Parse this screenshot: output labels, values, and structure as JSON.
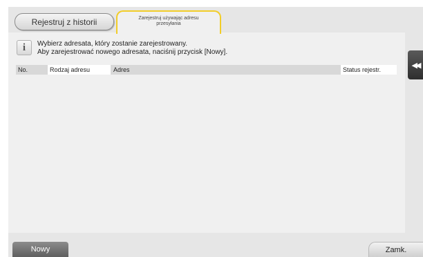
{
  "tabs": {
    "history_label": "Rejestruj z historii",
    "dest_label": "Zarejestruj używając adresu przesyłania"
  },
  "info": {
    "icon": "info-icon",
    "icon_glyph": "i",
    "line1": "Wybierz adresata, który zostanie zarejestrowany.",
    "line2": "Aby zarejestrować nowego adresata, naciśnij przycisk [Nowy]."
  },
  "table": {
    "columns": [
      "No.",
      "Rodzaj adresu",
      "Adres",
      "Status rejestr."
    ],
    "rows": []
  },
  "side": {
    "collapse_glyph": "◀◀"
  },
  "buttons": {
    "new_label": "Nowy",
    "close_label": "Zamk."
  },
  "colors": {
    "active_tab_border": "#f2cd28",
    "panel_bg": "#f0f0f0",
    "frame_bg": "#e6e6e6"
  }
}
